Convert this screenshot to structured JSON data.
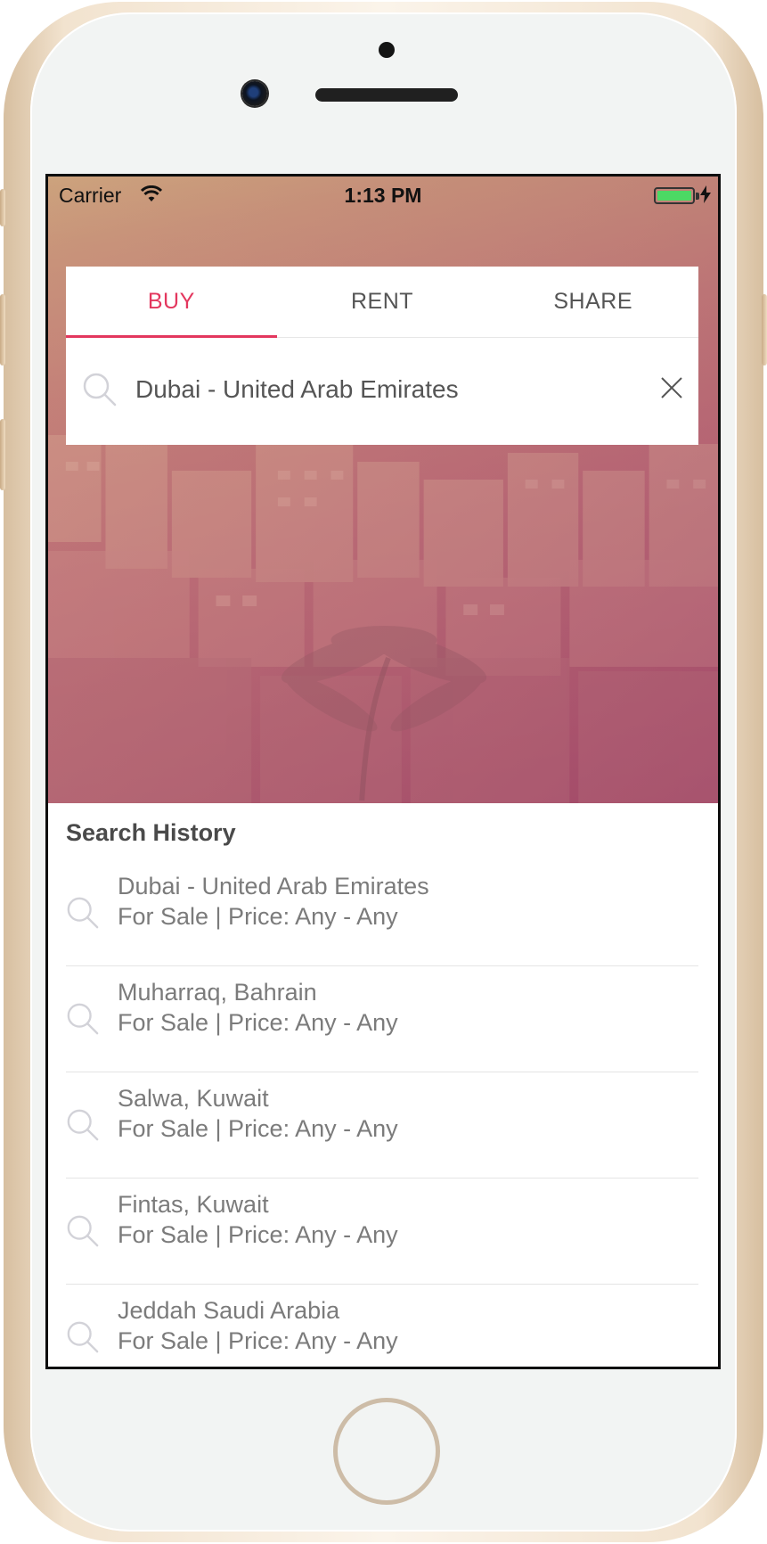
{
  "status_bar": {
    "carrier": "Carrier",
    "time": "1:13 PM",
    "battery_level": 1.0
  },
  "search": {
    "tabs": [
      {
        "label": "BUY",
        "active": true
      },
      {
        "label": "RENT",
        "active": false
      },
      {
        "label": "SHARE",
        "active": false
      }
    ],
    "query": "Dubai - United Arab Emirates",
    "search_icon": "search-icon",
    "clear_icon": "close-icon"
  },
  "history": {
    "title": "Search History",
    "items": [
      {
        "location": "Dubai - United Arab Emirates",
        "details": "For Sale | Price: Any - Any"
      },
      {
        "location": "Muharraq, Bahrain",
        "details": "For Sale | Price: Any - Any"
      },
      {
        "location": "Salwa, Kuwait",
        "details": "For Sale | Price: Any - Any"
      },
      {
        "location": "Fintas, Kuwait",
        "details": "For Sale | Price: Any - Any"
      },
      {
        "location": "Jeddah Saudi Arabia",
        "details": "For Sale | Price: Any - Any"
      }
    ]
  },
  "colors": {
    "accent": "#e3375e",
    "text_secondary": "#7b7b7b",
    "divider": "#e4e4e4",
    "battery": "#4cd964"
  }
}
